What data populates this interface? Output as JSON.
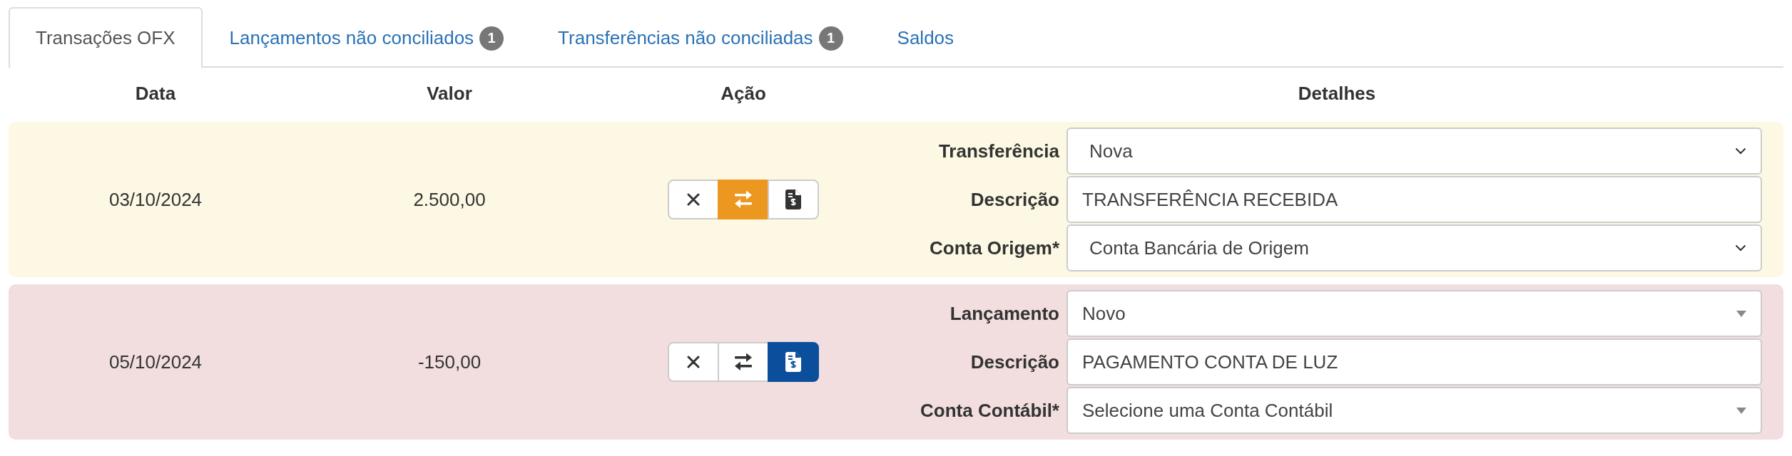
{
  "tabs": [
    {
      "label": "Transações OFX",
      "selected": true
    },
    {
      "label": "Lançamentos não conciliados",
      "badge": "1",
      "selected": false
    },
    {
      "label": "Transferências não conciliadas",
      "badge": "1",
      "selected": false
    },
    {
      "label": "Saldos",
      "selected": false
    }
  ],
  "table": {
    "columns": [
      "Data",
      "Valor",
      "Ação",
      "Detalhes"
    ],
    "rows": [
      {
        "color": "#fcf8e3",
        "date": "03/10/2024",
        "value": "2.500,00",
        "actions": [
          {
            "kind": "ignore",
            "selected": false
          },
          {
            "kind": "transfer",
            "selected": true
          },
          {
            "kind": "document",
            "selected": false
          }
        ],
        "fields": [
          {
            "label": "Transferência",
            "kind": "chevron-select",
            "value": "Nova"
          },
          {
            "label": "Descrição",
            "kind": "text",
            "value": "TRANSFERÊNCIA RECEBIDA"
          },
          {
            "label": "Conta Origem*",
            "kind": "chevron-select",
            "value": "Conta Bancária de Origem"
          }
        ]
      },
      {
        "color": "#f2dede",
        "date": "05/10/2024",
        "value": "-150,00",
        "actions": [
          {
            "kind": "ignore",
            "selected": false
          },
          {
            "kind": "transfer",
            "selected": false
          },
          {
            "kind": "document",
            "selected": true
          }
        ],
        "fields": [
          {
            "label": "Lançamento",
            "kind": "caret-select",
            "value": "Novo"
          },
          {
            "label": "Descrição",
            "kind": "text",
            "value": "PAGAMENTO CONTA DE LUZ"
          },
          {
            "label": "Conta Contábil*",
            "kind": "caret-select",
            "value": "Selecione uma Conta Contábil"
          }
        ]
      }
    ]
  }
}
